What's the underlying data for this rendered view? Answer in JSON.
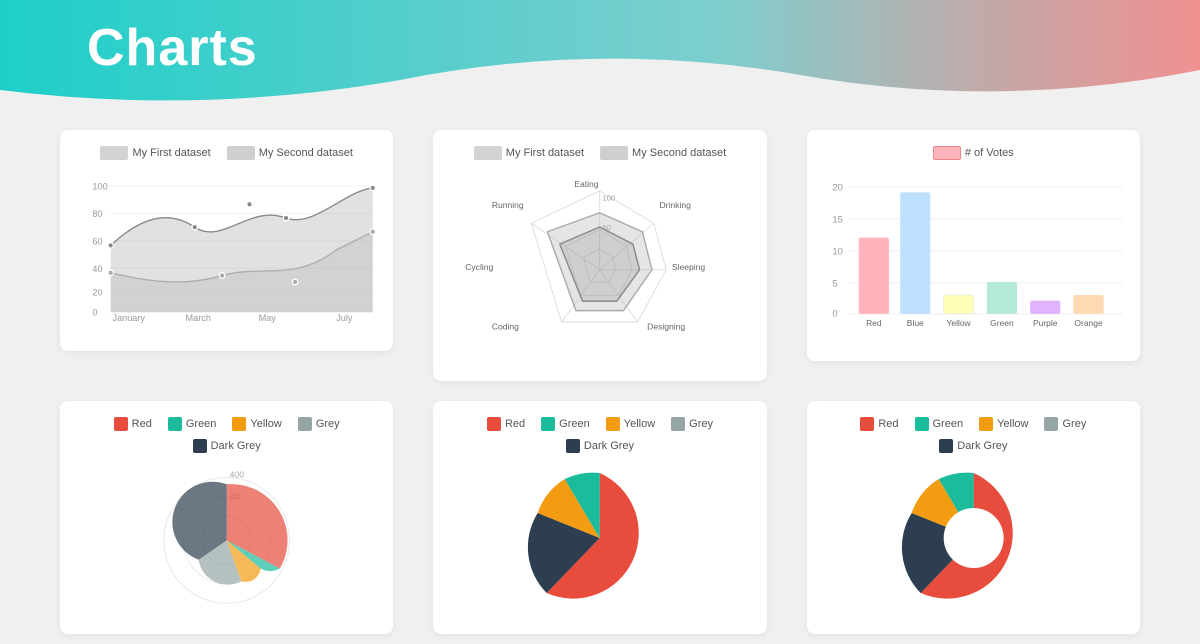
{
  "title": "Charts",
  "header": {
    "gradient_start": "#1ecfc9",
    "gradient_end": "#f08080"
  },
  "line_chart": {
    "dataset1_label": "My First dataset",
    "dataset2_label": "My Second dataset",
    "x_labels": [
      "January",
      "March",
      "May",
      "July"
    ],
    "y_labels": [
      "0",
      "20",
      "40",
      "60",
      "80",
      "100"
    ]
  },
  "radar_chart": {
    "dataset1_label": "My First dataset",
    "dataset2_label": "My Second dataset",
    "axes": [
      "Eating",
      "Drinking",
      "Sleeping",
      "Designing",
      "Coding",
      "Cycling",
      "Running"
    ],
    "levels": [
      "50",
      "100"
    ]
  },
  "bar_chart": {
    "legend_label": "# of Votes",
    "categories": [
      "Red",
      "Blue",
      "Yellow",
      "Green",
      "Purple",
      "Orange"
    ],
    "values": [
      12,
      19,
      3,
      5,
      2,
      3
    ],
    "colors": [
      "#ffb3ba",
      "#bde0fe",
      "#ffffba",
      "#b5ead7",
      "#e0b3ff",
      "#ffd9b3"
    ],
    "y_labels": [
      "0",
      "5",
      "10",
      "15",
      "20"
    ]
  },
  "pie_charts": {
    "legend": [
      {
        "label": "Red",
        "color": "#e74c3c"
      },
      {
        "label": "Green",
        "color": "#1abc9c"
      },
      {
        "label": "Yellow",
        "color": "#f39c12"
      },
      {
        "label": "Grey",
        "color": "#95a5a6"
      },
      {
        "label": "Dark Grey",
        "color": "#2c3e50"
      }
    ]
  }
}
